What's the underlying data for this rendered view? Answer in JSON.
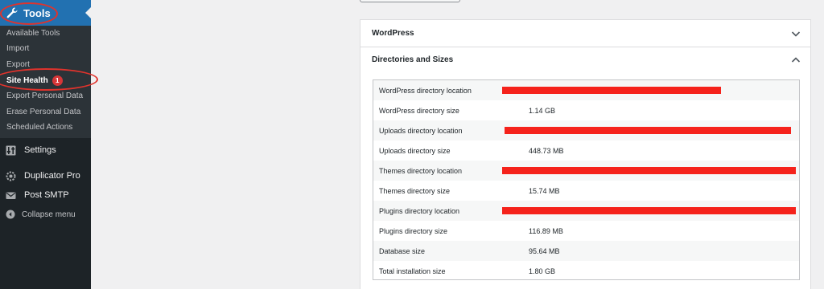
{
  "sidebar": {
    "tools_label": "Tools",
    "submenu": [
      {
        "label": "Available Tools"
      },
      {
        "label": "Import"
      },
      {
        "label": "Export"
      },
      {
        "label": "Site Health",
        "badge": "1"
      },
      {
        "label": "Export Personal Data"
      },
      {
        "label": "Erase Personal Data"
      },
      {
        "label": "Scheduled Actions"
      }
    ],
    "items": [
      {
        "label": "Settings",
        "icon": "settings-icon"
      },
      {
        "label": "Duplicator Pro",
        "icon": "duplicator-icon"
      },
      {
        "label": "Post SMTP",
        "icon": "mail-icon"
      }
    ],
    "collapse_label": "Collapse menu"
  },
  "sections": {
    "wordpress": {
      "title": "WordPress",
      "expanded": false
    },
    "directories": {
      "title": "Directories and Sizes",
      "expanded": true,
      "rows": [
        {
          "key": "WordPress directory location",
          "value": "",
          "redacted": true
        },
        {
          "key": "WordPress directory size",
          "value": "1.14 GB"
        },
        {
          "key": "Uploads directory location",
          "value": "",
          "redacted": true
        },
        {
          "key": "Uploads directory size",
          "value": "448.73 MB"
        },
        {
          "key": "Themes directory location",
          "value": "",
          "redacted": true
        },
        {
          "key": "Themes directory size",
          "value": "15.74 MB"
        },
        {
          "key": "Plugins directory location",
          "value": "",
          "redacted": true
        },
        {
          "key": "Plugins directory size",
          "value": "116.89 MB"
        },
        {
          "key": "Database size",
          "value": "95.64 MB"
        },
        {
          "key": "Total installation size",
          "value": "1.80 GB"
        }
      ]
    }
  },
  "colors": {
    "sidebar_bg": "#1d2327",
    "submenu_bg": "#2c3338",
    "active_blue": "#2271b1",
    "badge_red": "#d63638",
    "annotation_red": "#e0332c",
    "redaction_red": "#f5221b"
  }
}
